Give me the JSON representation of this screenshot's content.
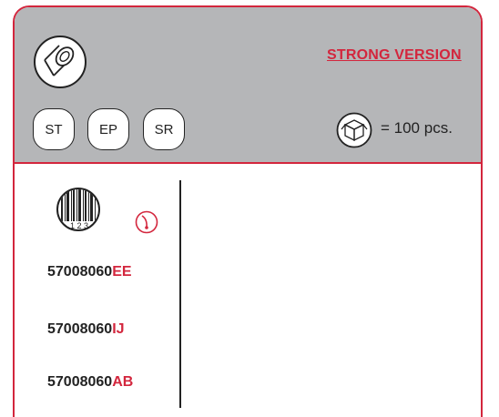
{
  "header": {
    "version_label": "STRONG VERSION",
    "product_icon": "pipe-fitting-icon",
    "variants": [
      "ST",
      "EP",
      "SR"
    ],
    "box_icon": "box-icon",
    "quantity_text": "= 100 pcs."
  },
  "codes_panel": {
    "barcode_icon": "barcode-icon",
    "barcode_digits": "1 2 3",
    "dial_icon": "dial-icon",
    "codes": [
      {
        "base": "57008060",
        "suffix": "EE"
      },
      {
        "base": "57008060",
        "suffix": "IJ"
      },
      {
        "base": "57008060",
        "suffix": "AB"
      }
    ]
  },
  "colors": {
    "accent": "#d3263d",
    "header_bg": "#b5b6b8",
    "text": "#222222"
  }
}
